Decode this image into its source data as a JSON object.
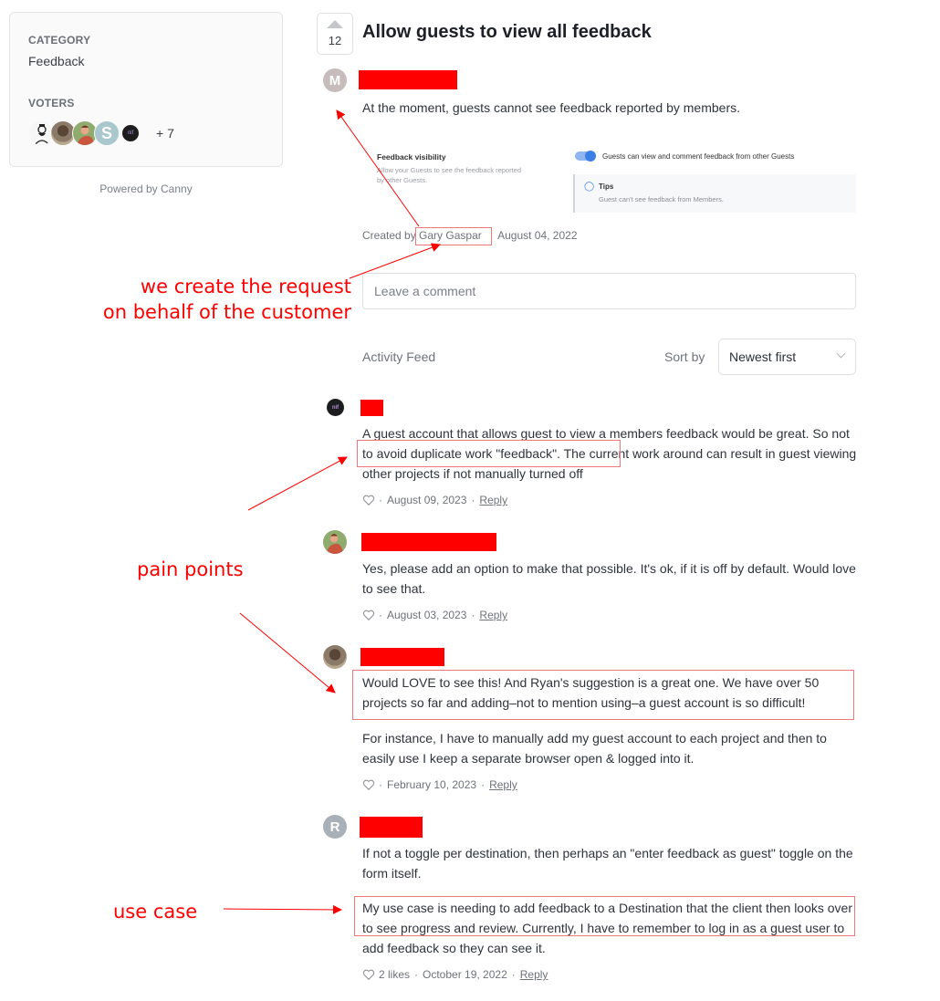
{
  "sidebar": {
    "category_label": "CATEGORY",
    "category_value": "Feedback",
    "voters_label": "VOTERS",
    "voters": [
      {
        "name": "voter-illustrated-man"
      },
      {
        "name": "voter-photo-woman"
      },
      {
        "name": "voter-illustrated-person"
      },
      {
        "name": "voter-s",
        "initial": "S"
      },
      {
        "name": "voter-nif-logo",
        "initial": "nif"
      }
    ],
    "voters_more": "+ 7",
    "powered_by": "Powered by Canny"
  },
  "post": {
    "vote_count": "12",
    "title": "Allow guests to view all feedback",
    "author_initial": "M",
    "body": "At the moment, guests cannot see feedback reported by members.",
    "embed": {
      "title": "Feedback visibility",
      "description": "Allow your Guests to see the feedback reported by other Guests.",
      "toggle_label": "Guests can view and comment feedback from other Guests",
      "toggle_on": true,
      "tips_title": "Tips",
      "tips_text": "Guest can't see feedback from Members."
    },
    "created_by_prefix": "Created by",
    "created_by_name": "Gary Gaspar",
    "created_date": "August 04, 2022"
  },
  "comment_box": {
    "placeholder": "Leave a comment"
  },
  "feed": {
    "label": "Activity Feed",
    "sort_label": "Sort by",
    "sort_value": "Newest first"
  },
  "comments": [
    {
      "avatar": "nif-logo",
      "paragraphs": [
        "A guest account that allows guest to view a members feedback would be great. So not to avoid duplicate work \"feedback\". The current work around can result in guest viewing other projects if not manually turned off"
      ],
      "likes": "",
      "date": "August 09, 2023",
      "reply": "Reply"
    },
    {
      "avatar": "illustrated-person",
      "paragraphs": [
        "Yes, please add an option to make that possible. It's ok, if it is off by default. Would love to see that."
      ],
      "likes": "",
      "date": "August 03, 2023",
      "reply": "Reply"
    },
    {
      "avatar": "photo-woman",
      "paragraphs": [
        "Would LOVE to see this! And Ryan's suggestion is a great one. We have over 50 projects so far and adding–not to mention using–a guest account is so difficult!",
        "For instance, I have to manually add my guest account to each project and then to easily use I keep a separate browser open & logged into it."
      ],
      "likes": "",
      "date": "February 10, 2023",
      "reply": "Reply"
    },
    {
      "avatar": "R",
      "paragraphs": [
        "If not a toggle per destination, then perhaps an \"enter feedback as guest\" toggle on the form itself.",
        "My use case is needing to add feedback to a Destination that the client then looks over to see progress and review. Currently, I have to remember to log in as a guest user to add feedback so they can see it."
      ],
      "likes": "2 likes",
      "date": "October 19, 2022",
      "reply": "Reply"
    }
  ],
  "annotations": {
    "created_on_behalf_line1": "we create the request",
    "created_on_behalf_line2": "on behalf of the customer",
    "pain_points": "pain points",
    "use_case": "use case",
    "color": "#ff0000"
  },
  "meta_separator": "·"
}
